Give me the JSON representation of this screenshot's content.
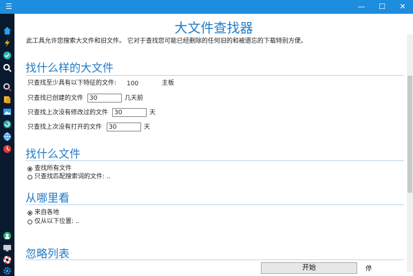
{
  "titlebar": {
    "menu_icon": "menu-icon",
    "controls": [
      "minimize-icon",
      "maximize-icon",
      "close-icon"
    ]
  },
  "sidebar": {
    "icons": [
      "home-icon",
      "lightning-icon",
      "checkmark-icon",
      "search-icon",
      "magnifier-icon",
      "documents-icon",
      "image-icon",
      "refresh-icon",
      "globe-icon",
      "clock-icon",
      "user-icon",
      "monitor-icon",
      "lifebuoy-icon",
      "gear-icon"
    ]
  },
  "header": {
    "title": "大文件查找器",
    "description": "此工具允许您搜索大文件和旧文件。 它对于查找您可能已经删除的任何旧的和被遗忘的下载特别方便。"
  },
  "section1": {
    "title": "找什么样的大文件",
    "rows": [
      {
        "label": "只查找至少具有以下特征的文件:",
        "value": "100",
        "unit": "主板"
      },
      {
        "label": "只查找已创建的文件",
        "value": "30",
        "unit": "几天前"
      },
      {
        "label": "只查找上次没有修改过的文件",
        "value": "30",
        "unit": "天"
      },
      {
        "label": "只查找上次没有打开的文件",
        "value": "30",
        "unit": "天"
      }
    ]
  },
  "section2": {
    "title": "找什么文件",
    "options": [
      {
        "label": "查找所有文件",
        "selected": true
      },
      {
        "label": "只查找匹配搜索词的文件: ..",
        "selected": false
      }
    ]
  },
  "section3": {
    "title": "从哪里看",
    "options": [
      {
        "label": "来自各地",
        "selected": true
      },
      {
        "label": "仅从以下位置: ..",
        "selected": false
      }
    ]
  },
  "section4": {
    "title": "忽略列表"
  },
  "footer": {
    "start_label": "开始",
    "stop_label": "停"
  },
  "colors": {
    "accent": "#1f7bc7",
    "titlebar": "#1d8ddd",
    "sidebar": "#0a1a2e"
  }
}
